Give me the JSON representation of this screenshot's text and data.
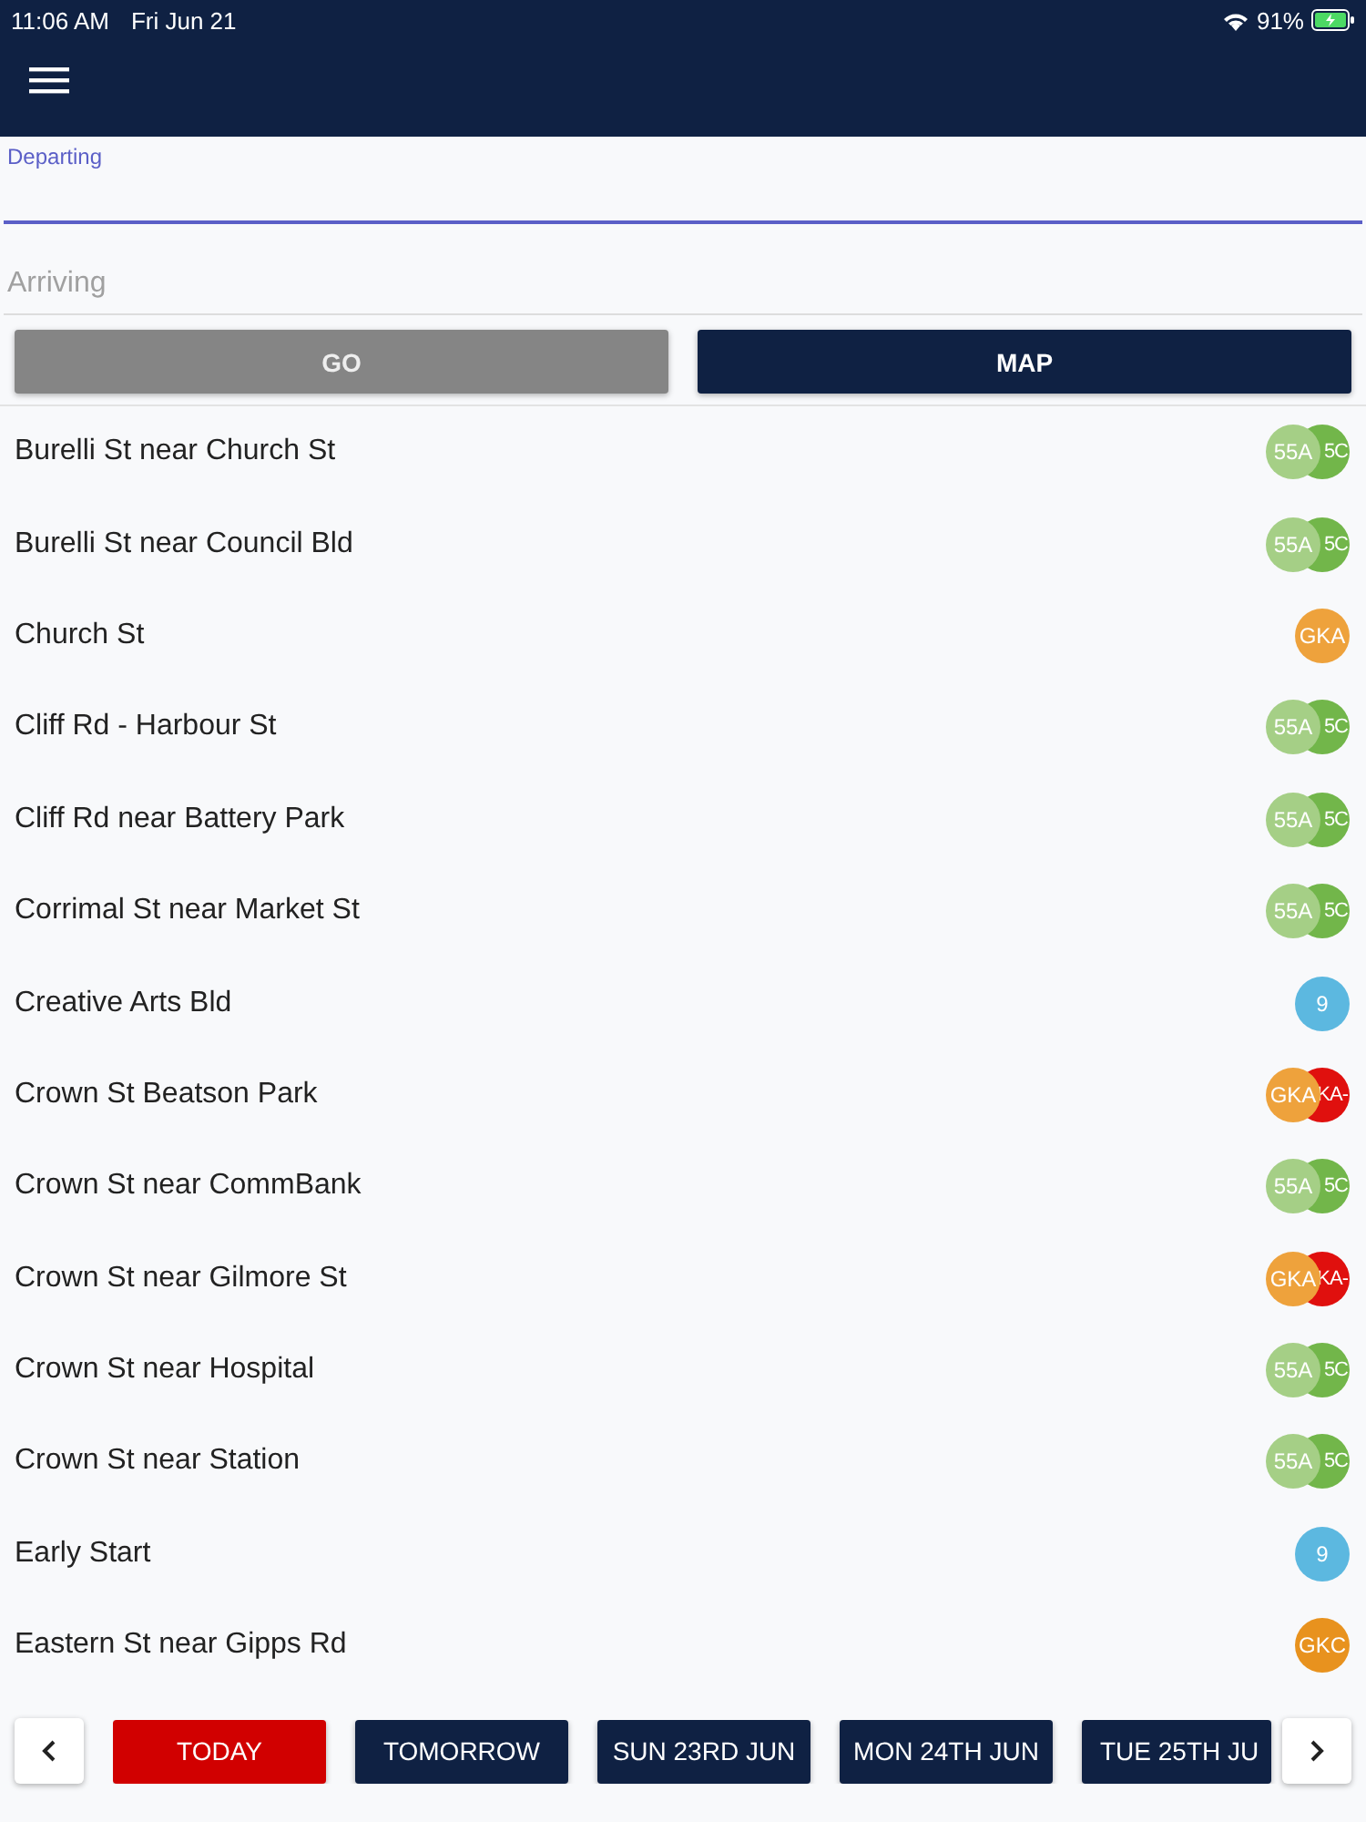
{
  "status_bar": {
    "time": "11:06 AM",
    "date": "Fri Jun 21",
    "battery": "91%"
  },
  "fields": [
    {
      "label": "Departing",
      "focused": true
    },
    {
      "placeholder": "Arriving",
      "focused": false
    }
  ],
  "buttons": [
    {
      "label": "GO",
      "disabled": true
    },
    {
      "label": "MAP",
      "disabled": false
    }
  ],
  "stops": [
    {
      "name": "Burelli St near Church St",
      "badges": [
        {
          "text": "55A",
          "color": "#a5cf86"
        },
        {
          "text": "5C",
          "color": "#72b64a"
        }
      ]
    },
    {
      "name": "Burelli St near Council Bld",
      "badges": [
        {
          "text": "55A",
          "color": "#a5cf86"
        },
        {
          "text": "5C",
          "color": "#72b64a"
        }
      ]
    },
    {
      "name": "Church St",
      "badges": [
        {
          "text": "GKA",
          "color": "#eea23c"
        }
      ]
    },
    {
      "name": "Cliff Rd - Harbour St",
      "badges": [
        {
          "text": "55A",
          "color": "#a5cf86"
        },
        {
          "text": "5C",
          "color": "#72b64a"
        }
      ]
    },
    {
      "name": "Cliff Rd near Battery Park",
      "badges": [
        {
          "text": "55A",
          "color": "#a5cf86"
        },
        {
          "text": "5C",
          "color": "#72b64a"
        }
      ]
    },
    {
      "name": "Corrimal St near Market St",
      "badges": [
        {
          "text": "55A",
          "color": "#a5cf86"
        },
        {
          "text": "5C",
          "color": "#72b64a"
        }
      ]
    },
    {
      "name": "Creative Arts Bld",
      "badges": [
        {
          "text": "9",
          "color": "#5cb8e0"
        }
      ]
    },
    {
      "name": "Crown St Beatson Park",
      "badges": [
        {
          "text": "GKA",
          "color": "#eea23c"
        },
        {
          "text": "KA-",
          "color": "#e0100e"
        }
      ]
    },
    {
      "name": "Crown St near CommBank",
      "badges": [
        {
          "text": "55A",
          "color": "#a5cf86"
        },
        {
          "text": "5C",
          "color": "#72b64a"
        }
      ]
    },
    {
      "name": "Crown St near Gilmore St",
      "badges": [
        {
          "text": "GKA",
          "color": "#eea23c"
        },
        {
          "text": "KA-",
          "color": "#e0100e"
        }
      ]
    },
    {
      "name": "Crown St near Hospital",
      "badges": [
        {
          "text": "55A",
          "color": "#a5cf86"
        },
        {
          "text": "5C",
          "color": "#72b64a"
        }
      ]
    },
    {
      "name": "Crown St near Station",
      "badges": [
        {
          "text": "55A",
          "color": "#a5cf86"
        },
        {
          "text": "5C",
          "color": "#72b64a"
        }
      ]
    },
    {
      "name": "Early Start",
      "badges": [
        {
          "text": "9",
          "color": "#5cb8e0"
        }
      ]
    },
    {
      "name": "Eastern St near Gipps Rd",
      "badges": [
        {
          "text": "GKC",
          "color": "#e8921e"
        }
      ]
    }
  ],
  "days": [
    {
      "label": "TODAY",
      "selected": true
    },
    {
      "label": "TOMORROW",
      "selected": false
    },
    {
      "label": "SUN 23RD JUN",
      "selected": false
    },
    {
      "label": "MON 24TH JUN",
      "selected": false
    },
    {
      "label": "TUE 25TH JU",
      "selected": false
    }
  ]
}
